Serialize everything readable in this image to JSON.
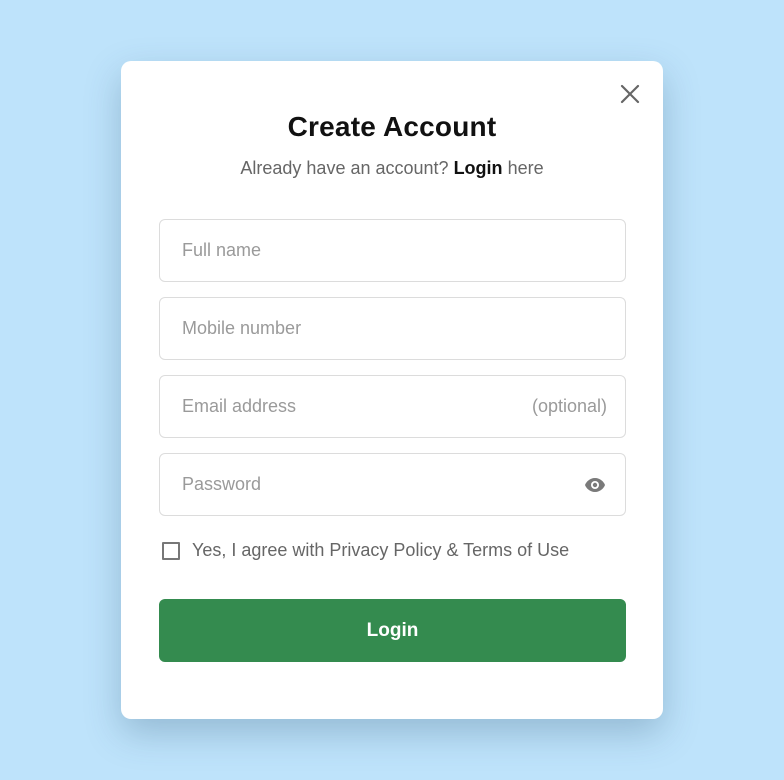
{
  "modal": {
    "title": "Create Account",
    "subtitle_prefix": "Already have an account?",
    "subtitle_link": "Login",
    "subtitle_suffix": "here",
    "close_icon": "close-icon"
  },
  "form": {
    "full_name": {
      "placeholder": "Full name",
      "value": ""
    },
    "mobile": {
      "placeholder": "Mobile number",
      "value": ""
    },
    "email": {
      "placeholder": "Email address",
      "value": "",
      "suffix": "(optional)"
    },
    "password": {
      "placeholder": "Password",
      "value": "",
      "toggle_icon": "eye-icon"
    },
    "agree": {
      "label": "Yes, I agree with Privacy Policy & Terms of Use",
      "checked": false
    },
    "submit_label": "Login"
  },
  "colors": {
    "background": "#bee3fb",
    "primary_button": "#348b4f",
    "card": "#ffffff"
  }
}
